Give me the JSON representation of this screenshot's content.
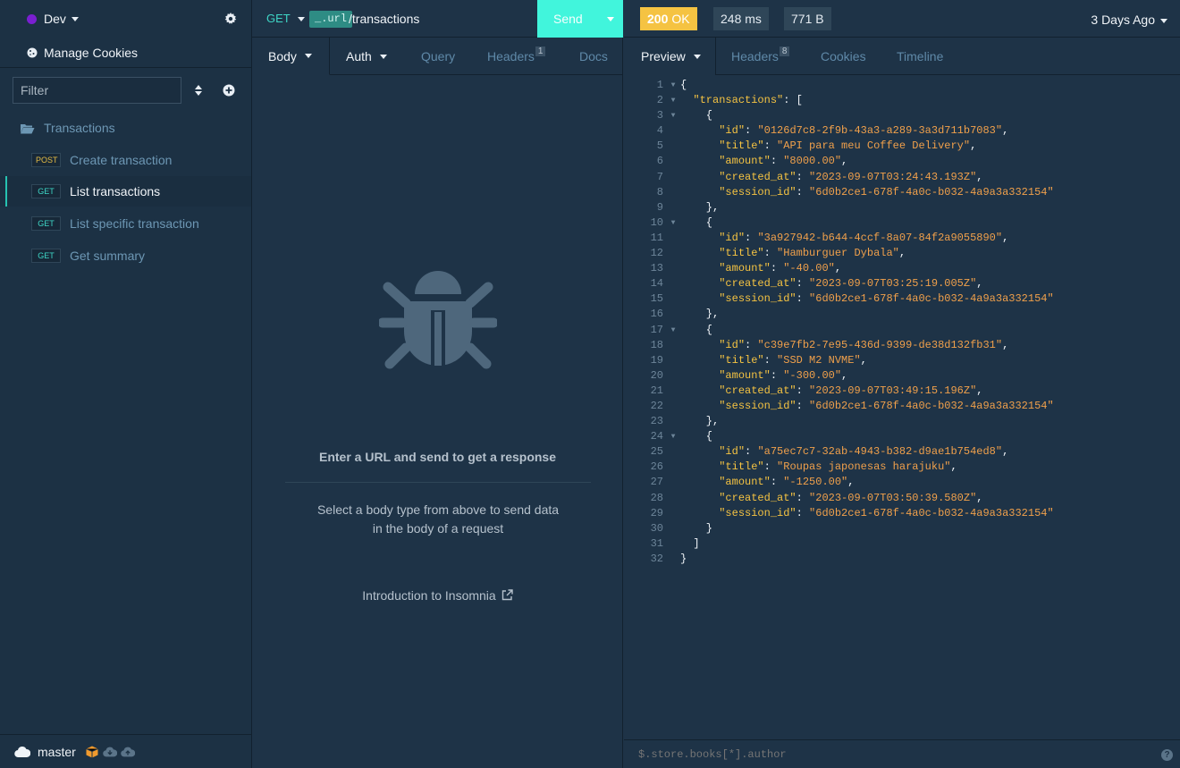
{
  "sidebar": {
    "environment": "Dev",
    "environment_color": "#7a1fd1",
    "manage_cookies": "Manage Cookies",
    "filter_placeholder": "Filter",
    "folder": "Transactions",
    "requests": [
      {
        "method": "POST",
        "label": "Create transaction",
        "active": false
      },
      {
        "method": "GET",
        "label": "List transactions",
        "active": true
      },
      {
        "method": "GET",
        "label": "List specific transaction",
        "active": false
      },
      {
        "method": "GET",
        "label": "Get summary",
        "active": false
      }
    ],
    "branch": "master"
  },
  "request": {
    "method": "GET",
    "url_variable": "_.url",
    "url_path": "/transactions",
    "send_label": "Send",
    "tabs": {
      "body": "Body",
      "auth": "Auth",
      "query": "Query",
      "headers": "Headers",
      "headers_count": "1",
      "docs": "Docs"
    },
    "empty_title": "Enter a URL and send to get a response",
    "empty_hint": "Select a body type from above to send data in the body of a request",
    "intro_link": "Introduction to Insomnia"
  },
  "response": {
    "status_code": "200",
    "status_text": "OK",
    "time": "248 ms",
    "size": "771 B",
    "time_ago": "3 Days Ago",
    "tabs": {
      "preview": "Preview",
      "headers": "Headers",
      "headers_count": "8",
      "cookies": "Cookies",
      "timeline": "Timeline"
    },
    "body": {
      "transactions": [
        {
          "id": "0126d7c8-2f9b-43a3-a289-3a3d711b7083",
          "title": "API para meu Coffee Delivery",
          "amount": "8000.00",
          "created_at": "2023-09-07T03:24:43.193Z",
          "session_id": "6d0b2ce1-678f-4a0c-b032-4a9a3a332154"
        },
        {
          "id": "3a927942-b644-4ccf-8a07-84f2a9055890",
          "title": "Hamburguer Dybala",
          "amount": "-40.00",
          "created_at": "2023-09-07T03:25:19.005Z",
          "session_id": "6d0b2ce1-678f-4a0c-b032-4a9a3a332154"
        },
        {
          "id": "c39e7fb2-7e95-436d-9399-de38d132fb31",
          "title": "SSD M2 NVME",
          "amount": "-300.00",
          "created_at": "2023-09-07T03:49:15.196Z",
          "session_id": "6d0b2ce1-678f-4a0c-b032-4a9a3a332154"
        },
        {
          "id": "a75ec7c7-32ab-4943-b382-d9ae1b754ed8",
          "title": "Roupas japonesas harajuku",
          "amount": "-1250.00",
          "created_at": "2023-09-07T03:50:39.580Z",
          "session_id": "6d0b2ce1-678f-4a0c-b032-4a9a3a332154"
        }
      ]
    },
    "filter_placeholder": "$.store.books[*].author",
    "help": "?"
  },
  "colors": {
    "accent": "#41f5dc",
    "status_ok": "#f5c342",
    "json_key": "#f5c342",
    "json_string": "#f0a04b"
  },
  "icons": {
    "settings": "gear-icon",
    "cookies": "cookie-icon",
    "sort": "sort-icon",
    "add": "plus-circle-icon",
    "folder": "folder-open-icon",
    "sync": "cloud-icon",
    "empty": "bug-icon",
    "external": "external-link-icon"
  }
}
